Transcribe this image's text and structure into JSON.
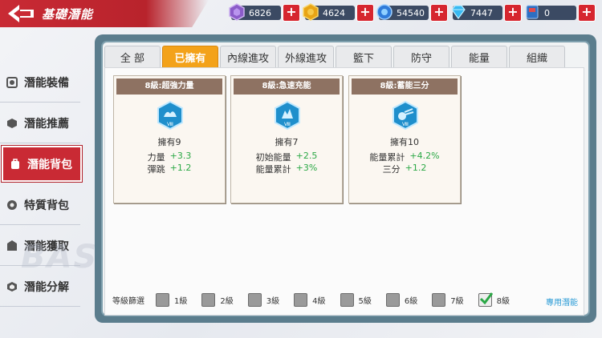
{
  "header": {
    "title": "基礎潛能"
  },
  "resources": [
    {
      "icon": "purple-gem-icon",
      "value": "6826"
    },
    {
      "icon": "gold-coin-icon",
      "value": "4624"
    },
    {
      "icon": "blue-orb-icon",
      "value": "54540"
    },
    {
      "icon": "diamond-icon",
      "value": "7447"
    },
    {
      "icon": "ticket-book-icon",
      "value": "0"
    }
  ],
  "resource_plus": "+",
  "sidebar": {
    "items": [
      {
        "label": "潛能裝備",
        "icon": "equip-icon"
      },
      {
        "label": "潛能推薦",
        "icon": "recommend-icon"
      },
      {
        "label": "潛能背包",
        "icon": "bag-icon",
        "active": true
      },
      {
        "label": "特質背包",
        "icon": "trait-icon"
      },
      {
        "label": "潛能獲取",
        "icon": "acquire-icon"
      },
      {
        "label": "潛能分解",
        "icon": "decompose-icon"
      }
    ],
    "watermark": "BASK"
  },
  "tabs": [
    {
      "label": "全 部"
    },
    {
      "label": "已擁有",
      "active": true
    },
    {
      "label": "內線進攻"
    },
    {
      "label": "外線進攻"
    },
    {
      "label": "籃下"
    },
    {
      "label": "防守"
    },
    {
      "label": "能量"
    },
    {
      "label": "組織"
    }
  ],
  "cards": [
    {
      "title": "8級:超強力量",
      "owned": "擁有9",
      "stats": [
        {
          "name": "力量",
          "value": "+3.3"
        },
        {
          "name": "彈跳",
          "value": "+1.2"
        }
      ],
      "icon": "power-icon"
    },
    {
      "title": "8級:急速充能",
      "owned": "擁有7",
      "stats": [
        {
          "name": "初始能量",
          "value": "+2.5"
        },
        {
          "name": "能量累計",
          "value": "+3%"
        }
      ],
      "icon": "charge-icon"
    },
    {
      "title": "8級:蓄能三分",
      "owned": "擁有10",
      "stats": [
        {
          "name": "能量累計",
          "value": "+4.2%"
        },
        {
          "name": "三分",
          "value": "+1.2"
        }
      ],
      "icon": "three-point-icon"
    }
  ],
  "card_badge": "Ⅷ",
  "filter": {
    "label": "等級篩選",
    "levels": [
      {
        "label": "1級",
        "checked": false
      },
      {
        "label": "2級",
        "checked": false
      },
      {
        "label": "3級",
        "checked": false
      },
      {
        "label": "4級",
        "checked": false
      },
      {
        "label": "5級",
        "checked": false
      },
      {
        "label": "6級",
        "checked": false
      },
      {
        "label": "7級",
        "checked": false
      },
      {
        "label": "8級",
        "checked": true
      }
    ]
  },
  "exclusive_link": "專用潛能",
  "colors": {
    "accent_red": "#c92a34",
    "tab_active": "#f3a21a",
    "stat_green": "#2aa845",
    "link_blue": "#2a9bd6"
  }
}
